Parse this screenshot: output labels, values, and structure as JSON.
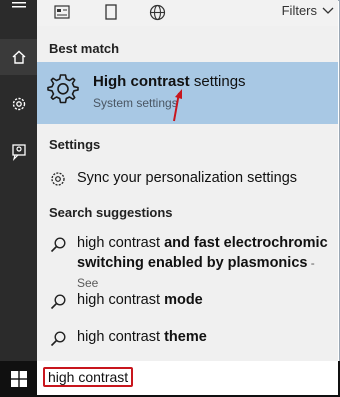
{
  "topbar": {
    "filters_label": "Filters"
  },
  "best_match": {
    "section_label": "Best match",
    "title_bold": "High contrast",
    "title_rest": " settings",
    "subtitle": "System settings"
  },
  "settings": {
    "section_label": "Settings",
    "items": [
      {
        "label": "Sync your personalization settings"
      }
    ]
  },
  "suggestions": {
    "section_label": "Search suggestions",
    "items": [
      {
        "prefix": "high contrast ",
        "bold_line1": "and fast electrochromic",
        "bold_line2": "switching enabled by plasmonics",
        "suffix": " - See"
      },
      {
        "prefix": "high contrast ",
        "bold": "mode"
      },
      {
        "prefix": "high contrast ",
        "bold": "theme"
      }
    ]
  },
  "search": {
    "value": "high contrast"
  },
  "colors": {
    "accent": "#a8c8e4",
    "highlight_border": "#c8161d",
    "rail": "#2b2b2b",
    "taskbar": "#101010"
  },
  "icons": {
    "rail": [
      "menu-icon",
      "home-icon",
      "gear-icon",
      "feedback-icon"
    ],
    "topbar": [
      "document-icon",
      "bookmark-icon",
      "globe-icon",
      "chevron-down-icon"
    ],
    "search": "magnifier-icon",
    "windows": "windows-logo-icon"
  }
}
